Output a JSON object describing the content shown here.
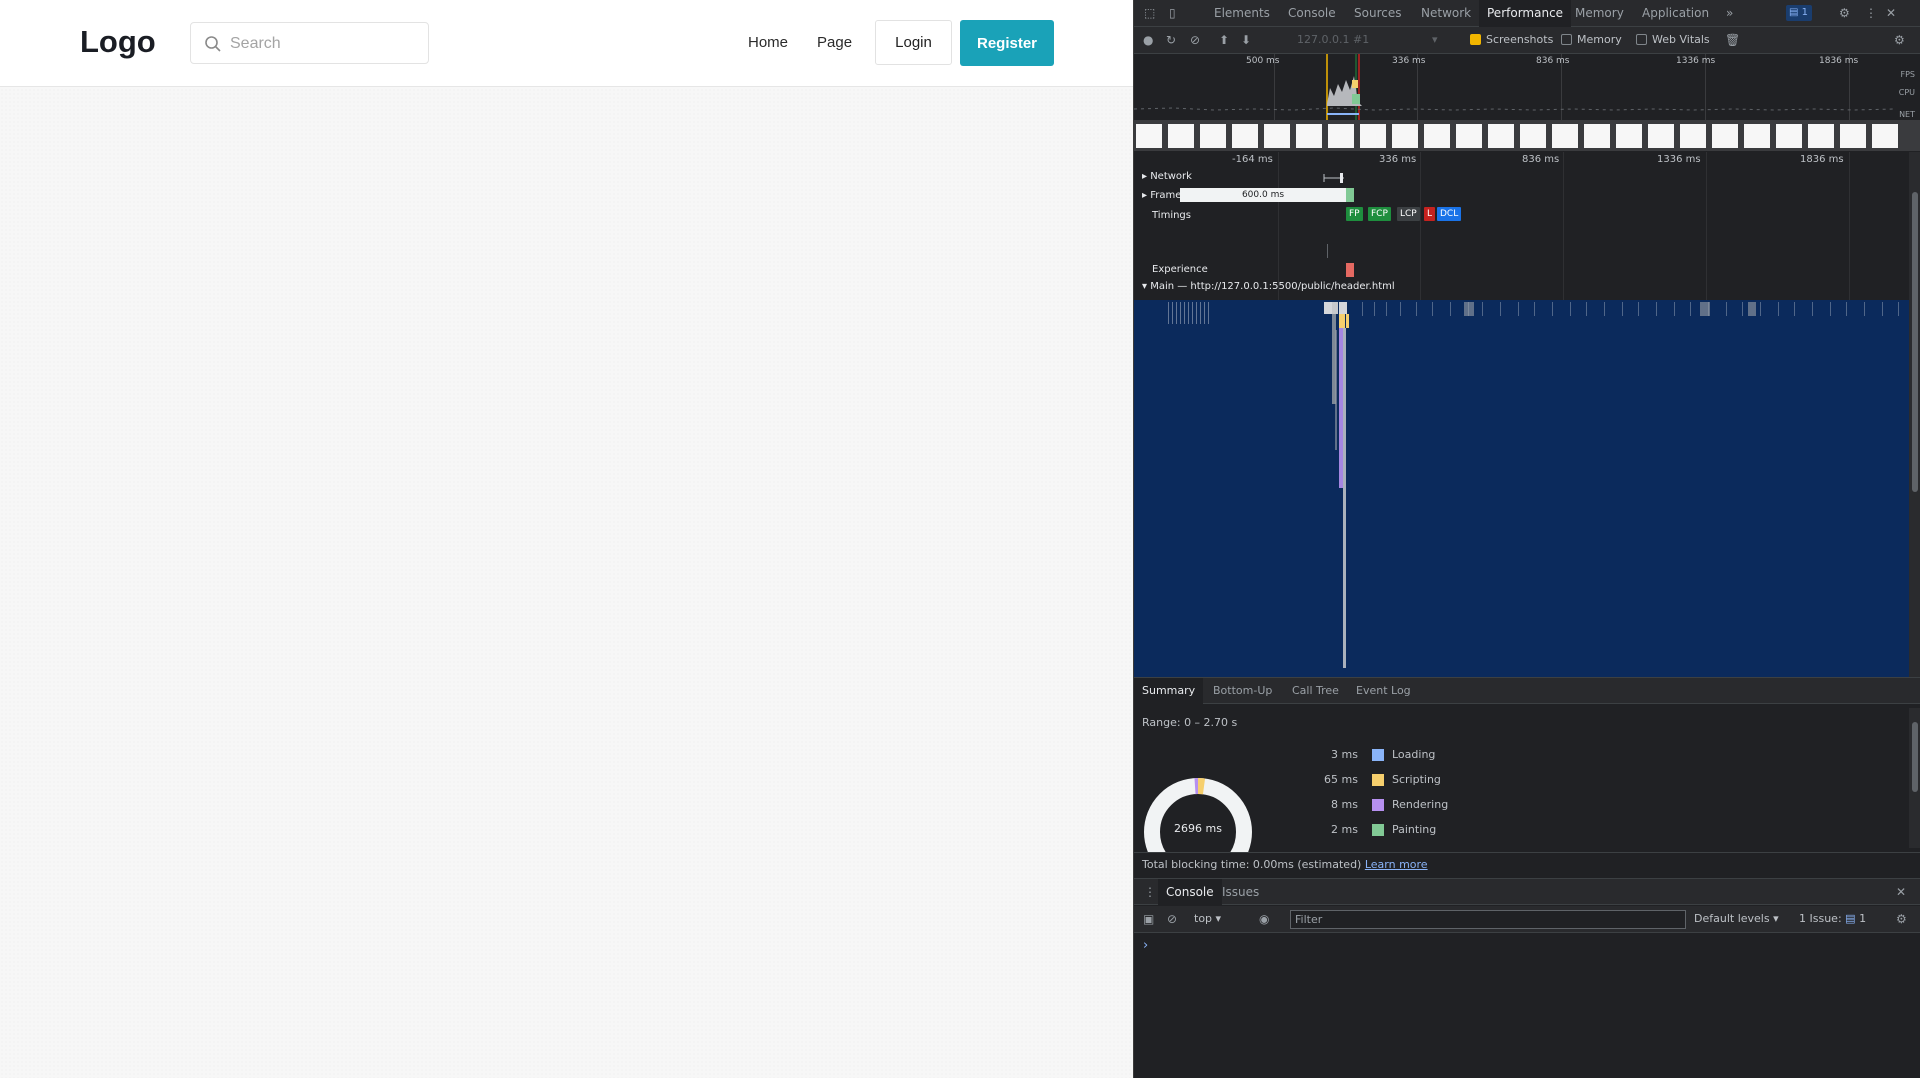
{
  "site": {
    "logo": "Logo",
    "search_placeholder": "Search",
    "nav": [
      "Home",
      "Page"
    ],
    "login_label": "Login",
    "register_label": "Register"
  },
  "devtools": {
    "tabs": [
      "Elements",
      "Console",
      "Sources",
      "Network",
      "Performance",
      "Memory",
      "Application"
    ],
    "active_tab": "Performance",
    "more_tabs": "»",
    "issues_badge": "1",
    "toolbar": {
      "target": "127.0.0.1 #1",
      "screenshots_label": "Screenshots",
      "memory_label": "Memory",
      "web_vitals_label": "Web Vitals"
    },
    "overview": {
      "ticks": [
        "500 ms",
        "336 ms",
        "836 ms",
        "1336 ms",
        "1836 ms"
      ],
      "lane_labels": [
        "FPS",
        "CPU",
        "NET"
      ]
    },
    "timeline": {
      "ticks": [
        "-164 ms",
        "336 ms",
        "836 ms",
        "1336 ms",
        "1836 ms"
      ],
      "tracks": {
        "network": "Network",
        "frames": "Frames",
        "timings": "Timings",
        "experience": "Experience",
        "main": "Main — http://127.0.0.1:5500/public/header.html"
      },
      "frame_duration": "600.0 ms",
      "timing_markers": [
        "FP",
        "FCP",
        "LCP",
        "L",
        "DCL"
      ],
      "timing_colors": [
        "#1e8e3e",
        "#1e8e3e",
        "#202124",
        "#c5221f",
        "#1a73e8"
      ]
    },
    "summary_tabs": [
      "Summary",
      "Bottom-Up",
      "Call Tree",
      "Event Log"
    ],
    "summary": {
      "range": "Range: 0 – 2.70 s",
      "total": "2696 ms",
      "rows": [
        {
          "ms": "3 ms",
          "name": "Loading",
          "color": "#8ab4f8"
        },
        {
          "ms": "65 ms",
          "name": "Scripting",
          "color": "#f6cf6d"
        },
        {
          "ms": "8 ms",
          "name": "Rendering",
          "color": "#b690f0"
        },
        {
          "ms": "2 ms",
          "name": "Painting",
          "color": "#81c995"
        }
      ],
      "tbt_text": "Total blocking time: 0.00ms (estimated)",
      "learn_more": "Learn more"
    },
    "drawer": {
      "tabs": [
        "Console",
        "Issues"
      ],
      "context": "top",
      "filter_placeholder": "Filter",
      "levels": "Default levels",
      "issues_count": "1 Issue:",
      "issues_badge": "1",
      "prompt": "›"
    }
  }
}
